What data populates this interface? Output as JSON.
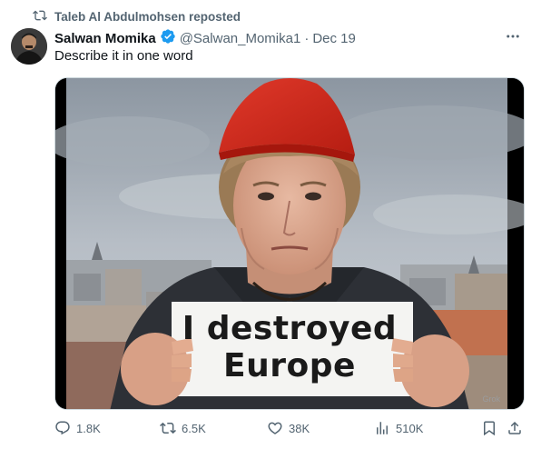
{
  "repost": {
    "text": "Taleb Al Abdulmohsen reposted",
    "icon": "repost-icon"
  },
  "author": {
    "name": "Salwan Momika",
    "verified": true,
    "handle": "@Salwan_Momika1",
    "separator": "·",
    "date": "Dec 19"
  },
  "tweet": {
    "text": "Describe it in one word"
  },
  "media": {
    "sign_line1": "I destroyed",
    "sign_line2": "Europe",
    "watermark": "Grok"
  },
  "actions": {
    "replies": "1.8K",
    "reposts": "6.5K",
    "likes": "38K",
    "views": "510K"
  },
  "colors": {
    "secondary_text": "#536471",
    "verified_blue": "#1d9bf0",
    "hat_red": "#d62b1e"
  }
}
